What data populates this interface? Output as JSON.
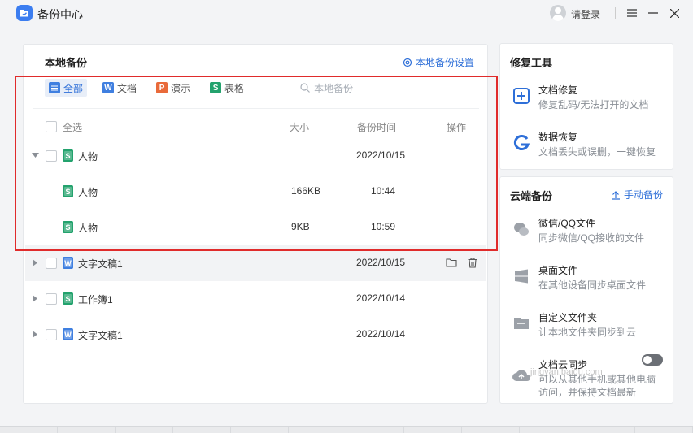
{
  "window": {
    "title": "备份中心",
    "login_label": "请登录"
  },
  "local_backup": {
    "title": "本地备份",
    "settings_label": "本地备份设置",
    "filters": [
      {
        "label": "全部",
        "icon": "list-icon",
        "active": true
      },
      {
        "label": "文档",
        "icon": "writer-icon",
        "active": false
      },
      {
        "label": "演示",
        "icon": "presentation-icon",
        "active": false
      },
      {
        "label": "表格",
        "icon": "spreadsheet-icon",
        "active": false
      }
    ],
    "search_placeholder": "本地备份",
    "columns": {
      "select_all": "全选",
      "size": "大小",
      "time": "备份时间",
      "action": "操作"
    },
    "rows": [
      {
        "name": "人物",
        "type": "sheet",
        "size": "",
        "time": "2022/10/15",
        "expanded": true,
        "level": 0
      },
      {
        "name": "人物",
        "type": "sheet",
        "size": "166KB",
        "time": "10:44",
        "level": 1
      },
      {
        "name": "人物",
        "type": "sheet",
        "size": "9KB",
        "time": "10:59",
        "level": 1
      },
      {
        "name": "文字文稿1",
        "type": "doc",
        "size": "",
        "time": "2022/10/15",
        "expanded": false,
        "level": 0,
        "hover": true
      },
      {
        "name": "工作簿1",
        "type": "sheet",
        "size": "",
        "time": "2022/10/14",
        "expanded": false,
        "level": 0
      },
      {
        "name": "文字文稿1",
        "type": "doc",
        "size": "",
        "time": "2022/10/14",
        "expanded": false,
        "level": 0
      }
    ]
  },
  "repair_tools": {
    "title": "修复工具",
    "items": [
      {
        "name": "文档修复",
        "desc": "修复乱码/无法打开的文档",
        "icon": "document-repair-icon"
      },
      {
        "name": "数据恢复",
        "desc": "文档丢失或误删，一键恢复",
        "icon": "data-recovery-icon"
      }
    ]
  },
  "cloud_backup": {
    "title": "云端备份",
    "manual_label": "手动备份",
    "items": [
      {
        "name": "微信/QQ文件",
        "desc": "同步微信/QQ接收的文件",
        "icon": "chat-icon"
      },
      {
        "name": "桌面文件",
        "desc": "在其他设备同步桌面文件",
        "icon": "windows-icon"
      },
      {
        "name": "自定义文件夹",
        "desc": "让本地文件夹同步到云",
        "icon": "folder-icon"
      },
      {
        "name": "文档云同步",
        "desc": "可以从其他手机或其他电脑",
        "icon": "cloud-upload-icon"
      }
    ],
    "extra_line": "访问，并保持文档最新"
  },
  "watermark": "jingyan.baidu.com",
  "colors": {
    "accent": "#2e6fd8",
    "highlight_box": "#e02b2b",
    "sheet": "#23a26d",
    "doc": "#3f7fe0",
    "presentation": "#e96a3a"
  }
}
